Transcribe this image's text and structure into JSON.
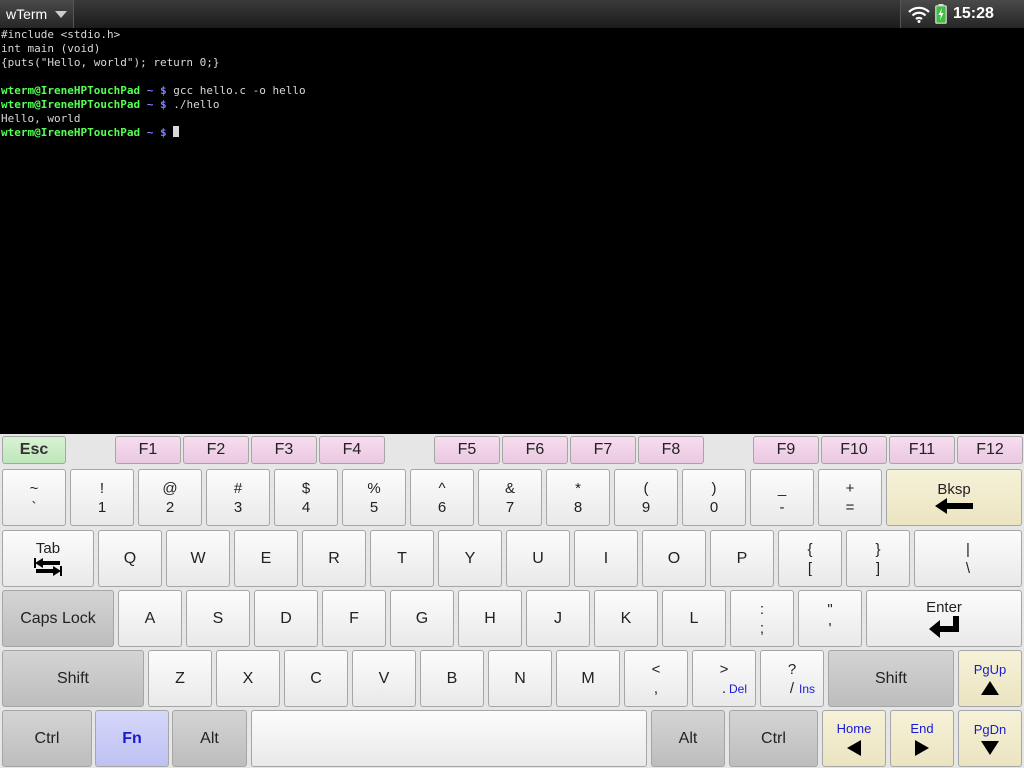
{
  "statusbar": {
    "app_title": "wTerm",
    "clock": "15:28",
    "icons": [
      "wifi-icon",
      "battery-icon"
    ]
  },
  "terminal": {
    "lines": [
      {
        "type": "text",
        "text": "#include <stdio.h>"
      },
      {
        "type": "text",
        "text": "int main (void)"
      },
      {
        "type": "text",
        "text": "{puts(\"Hello, world\"); return 0;}"
      },
      {
        "type": "text",
        "text": ""
      },
      {
        "type": "prompt",
        "user": "wterm@IreneHPTouchPad",
        "tail": " ~ $",
        "cmd": " gcc hello.c -o hello"
      },
      {
        "type": "prompt",
        "user": "wterm@IreneHPTouchPad",
        "tail": " ~ $",
        "cmd": " ./hello"
      },
      {
        "type": "text",
        "text": "Hello, world"
      },
      {
        "type": "prompt",
        "user": "wterm@IreneHPTouchPad",
        "tail": " ~ $",
        "cmd": " ",
        "cursor": true
      }
    ]
  },
  "keyboard": {
    "esc": "Esc",
    "fkeys": [
      "F1",
      "F2",
      "F3",
      "F4",
      "F5",
      "F6",
      "F7",
      "F8",
      "F9",
      "F10",
      "F11",
      "F12"
    ],
    "number_row": [
      {
        "top": "~",
        "bot": "`"
      },
      {
        "top": "!",
        "bot": "1"
      },
      {
        "top": "@",
        "bot": "2"
      },
      {
        "top": "#",
        "bot": "3"
      },
      {
        "top": "$",
        "bot": "4"
      },
      {
        "top": "%",
        "bot": "5"
      },
      {
        "top": "^",
        "bot": "6"
      },
      {
        "top": "&",
        "bot": "7"
      },
      {
        "top": "*",
        "bot": "8"
      },
      {
        "top": "(",
        "bot": "9"
      },
      {
        "top": ")",
        "bot": "0"
      },
      {
        "top": "_",
        "bot": "-"
      },
      {
        "top": "+",
        "bot": "="
      }
    ],
    "bksp": "Bksp",
    "tab": "Tab",
    "qwerty_row": [
      "Q",
      "W",
      "E",
      "R",
      "T",
      "Y",
      "U",
      "I",
      "O",
      "P"
    ],
    "qwerty_sym": [
      {
        "top": "{",
        "bot": "["
      },
      {
        "top": "}",
        "bot": "]"
      },
      {
        "top": "|",
        "bot": "\\"
      }
    ],
    "caps": "Caps Lock",
    "home_row": [
      "A",
      "S",
      "D",
      "F",
      "G",
      "H",
      "J",
      "K",
      "L"
    ],
    "home_sym": [
      {
        "top": ":",
        "bot": ";"
      },
      {
        "top": "\"",
        "bot": "'"
      }
    ],
    "enter": "Enter",
    "shift": "Shift",
    "bottom_letters": [
      "Z",
      "X",
      "C",
      "V",
      "B",
      "N",
      "M"
    ],
    "bottom_sym": [
      {
        "top": "<",
        "bot": ",",
        "sub": ""
      },
      {
        "top": ">",
        "bot": ".",
        "sub": "Del"
      },
      {
        "top": "?",
        "bot": "/",
        "sub": "Ins"
      }
    ],
    "pgup": "PgUp",
    "ctrl": "Ctrl",
    "fn": "Fn",
    "alt": "Alt",
    "home": "Home",
    "end": "End",
    "pgdn": "PgDn"
  }
}
